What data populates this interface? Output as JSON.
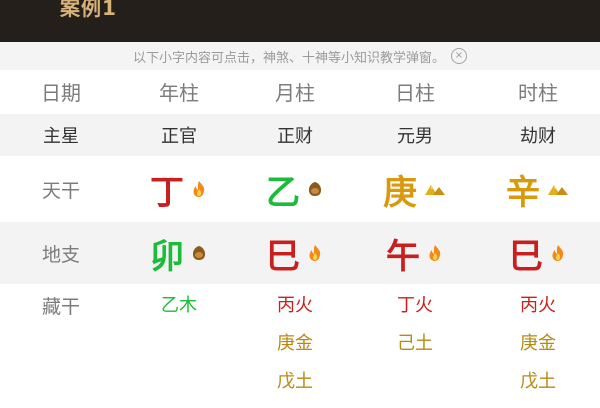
{
  "banner": {
    "title": "案例1"
  },
  "notice": {
    "text": "以下小字内容可点击，神煞、十神等小知识教学弹窗。",
    "close_symbol": "×"
  },
  "table": {
    "headers": {
      "label": "日期",
      "cols": [
        "年柱",
        "月柱",
        "日柱",
        "时柱"
      ]
    },
    "zhuxing": {
      "label": "主星",
      "cols": [
        "正官",
        "正财",
        "元男",
        "劫财"
      ]
    },
    "tiangan": {
      "label": "天干",
      "cols": [
        {
          "char": "丁",
          "color": "#c8201f",
          "icon": "fire-icon"
        },
        {
          "char": "乙",
          "color": "#1dbb3a",
          "icon": "earth-icon"
        },
        {
          "char": "庚",
          "color": "#d9990c",
          "icon": "gold-icon"
        },
        {
          "char": "辛",
          "color": "#d9990c",
          "icon": "gold-icon"
        }
      ]
    },
    "dizhi": {
      "label": "地支",
      "cols": [
        {
          "char": "卯",
          "color": "#1dbb3a",
          "icon": "earth-icon"
        },
        {
          "char": "巳",
          "color": "#c8201f",
          "icon": "fire-icon"
        },
        {
          "char": "午",
          "color": "#c8201f",
          "icon": "fire-icon"
        },
        {
          "char": "巳",
          "color": "#c8201f",
          "icon": "fire-icon"
        }
      ]
    },
    "canggan": {
      "label": "藏干",
      "cols": [
        [
          "乙木"
        ],
        [
          "丙火",
          "庚金",
          "戊土"
        ],
        [
          "丁火",
          "己土"
        ],
        [
          "丙火",
          "庚金",
          "戊土"
        ]
      ]
    }
  }
}
